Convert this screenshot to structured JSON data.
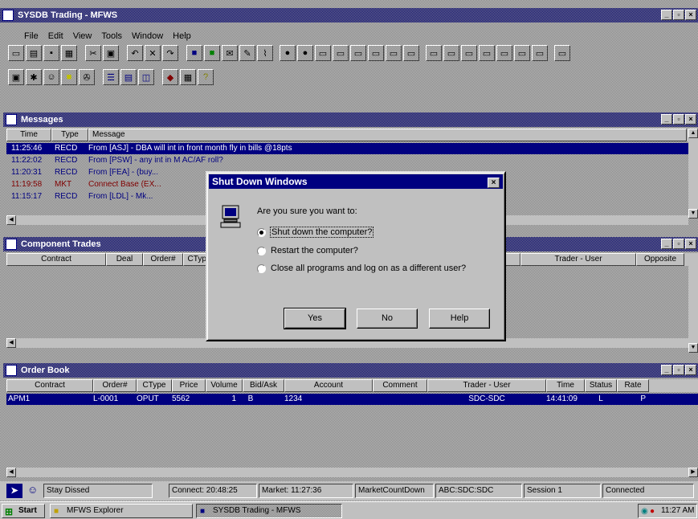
{
  "app": {
    "title": "SYSDB Trading - MFWS"
  },
  "menu": [
    "File",
    "Edit",
    "View",
    "Tools",
    "Window",
    "Help"
  ],
  "messages": {
    "title": "Messages",
    "columns": [
      "Time",
      "Type",
      "Message"
    ],
    "rows": [
      {
        "time": "11:25:46",
        "type": "RECD",
        "message": "From [ASJ] - DBA will int in front month fly in bills @18pts"
      },
      {
        "time": "11:22:02",
        "type": "RECD",
        "message": "From [PSW] - any int in M AC/AF roll?"
      },
      {
        "time": "11:20:31",
        "type": "RECD",
        "message": "From [FEA] - (buy..."
      },
      {
        "time": "11:19:58",
        "type": "MKT",
        "message": "Connect Base (EX..."
      },
      {
        "time": "11:15:17",
        "type": "RECD",
        "message": "From [LDL] - Mk..."
      }
    ]
  },
  "component": {
    "title": "Component Trades",
    "columns": [
      "Contract",
      "Deal",
      "Order#",
      "CType",
      "Trader - User",
      "Opposite"
    ]
  },
  "orders": {
    "title": "Order Book",
    "columns": [
      "Contract",
      "Order#",
      "CType",
      "Price",
      "Volume",
      "Bid/Ask",
      "Account",
      "Comment",
      "Trader - User",
      "Time",
      "Status",
      "Rate"
    ],
    "row": {
      "contract": "APM1",
      "order": "L-0001",
      "ctype": "OPUT",
      "price": "5562",
      "volume": "1",
      "bidask": "B",
      "account": "1234",
      "trader": "SDC-SDC",
      "time": "14:41:09",
      "status": "L",
      "rate": "P"
    }
  },
  "dialog": {
    "title": "Shut Down Windows",
    "question": "Are you sure you want to:",
    "options": [
      "Shut down the computer?",
      "Restart the computer?",
      "Close all programs and log on as a different user?"
    ],
    "selected": 0,
    "yes": "Yes",
    "no": "No",
    "help": "Help"
  },
  "statusbar": {
    "name": "Stay Dissed",
    "connect": "Connect: 20:48:25",
    "market": "Market: 11:27:36",
    "countdown": "MarketCountDown",
    "user": "ABC:SDC:SDC",
    "session": "Session 1",
    "connection": "Connected"
  },
  "taskbar": {
    "start": "Start",
    "items": [
      "MFWS Explorer",
      "SYSDB Trading - MFWS"
    ],
    "clock": "11:27 AM"
  }
}
